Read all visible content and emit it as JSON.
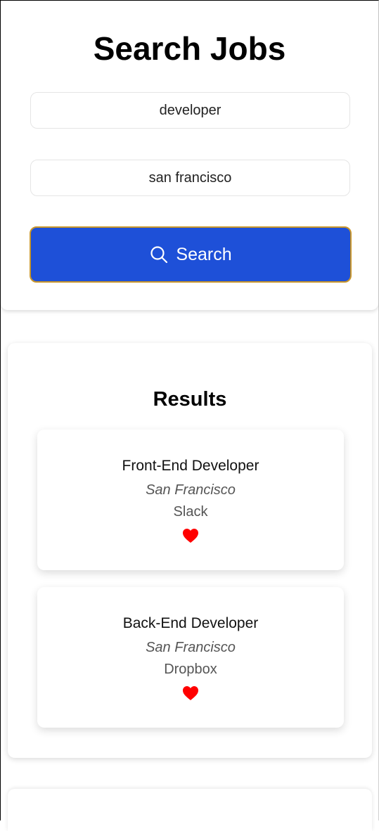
{
  "search": {
    "title": "Search Jobs",
    "keyword_value": "developer",
    "location_value": "san francisco",
    "button_label": "Search",
    "button_icon": "search-icon"
  },
  "results": {
    "title": "Results",
    "jobs": [
      {
        "title": "Front-End Developer",
        "location": "San Francisco",
        "company": "Slack",
        "favorite_icon": "heart-icon"
      },
      {
        "title": "Back-End Developer",
        "location": "San Francisco",
        "company": "Dropbox",
        "favorite_icon": "heart-icon"
      }
    ]
  },
  "colors": {
    "primary": "#1e50d8",
    "button_border": "#c9962a",
    "heart": "#ff0000"
  }
}
